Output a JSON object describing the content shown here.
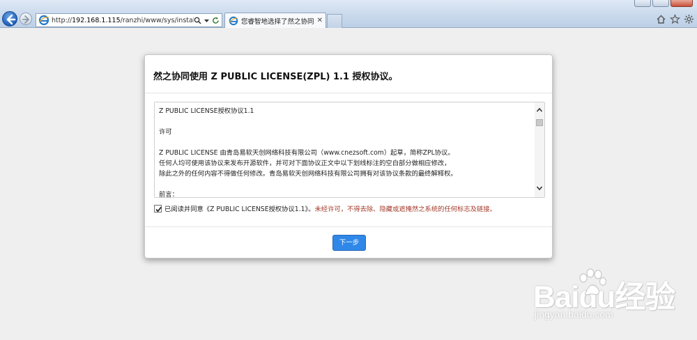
{
  "browser": {
    "address_url_prefix": "http://",
    "address_url_host": "192.168.1.115",
    "address_url_path": "/ranzhi/www/sys/install.php?m=ir",
    "tab_title": "您睿智地选择了然之协同! - ...",
    "tab_close": "✕",
    "icons": [
      "back-arrow-icon",
      "forward-arrow-icon",
      "ie-logo-icon",
      "search-icon",
      "refresh-icon",
      "home-icon",
      "star-icon",
      "gear-icon"
    ]
  },
  "modal": {
    "title": "然之协同使用 Z PUBLIC LICENSE(ZPL) 1.1 授权协议。",
    "license_lines": {
      "l1": "Z PUBLIC LICENSE授权协议1.1",
      "l2": "许可",
      "l3": "Z PUBLIC LICENSE 由青岛易软天创网络科技有限公司（www.cnezsoft.com）起草，简称ZPL协议。",
      "l4": "任何人均可使用该协议来发布开源软件，并可对下面协议正文中以下划线标注的空白部分做相应修改，",
      "l5": "除此之外的任何内容不得做任何修改。青岛易软天创网络科技有限公司拥有对该协议条款的最终解释权。",
      "l6": "前言："
    },
    "agree_label": "已阅读并同意《Z PUBLIC LICENSE授权协议1.1》。",
    "agree_warning": "未经许可，不得去除、隐藏或遮掩然之系统的任何标志及链接。",
    "agree_checked": true,
    "next_button": "下一步"
  },
  "watermark": {
    "brand_bai": "Bai",
    "brand_du": "du",
    "brand_cn": "经验",
    "sub": "jingyan.baidu.com"
  },
  "colors": {
    "accent": "#2f88e8",
    "warning_text": "#a33a2a",
    "page_bg": "#efefef"
  }
}
